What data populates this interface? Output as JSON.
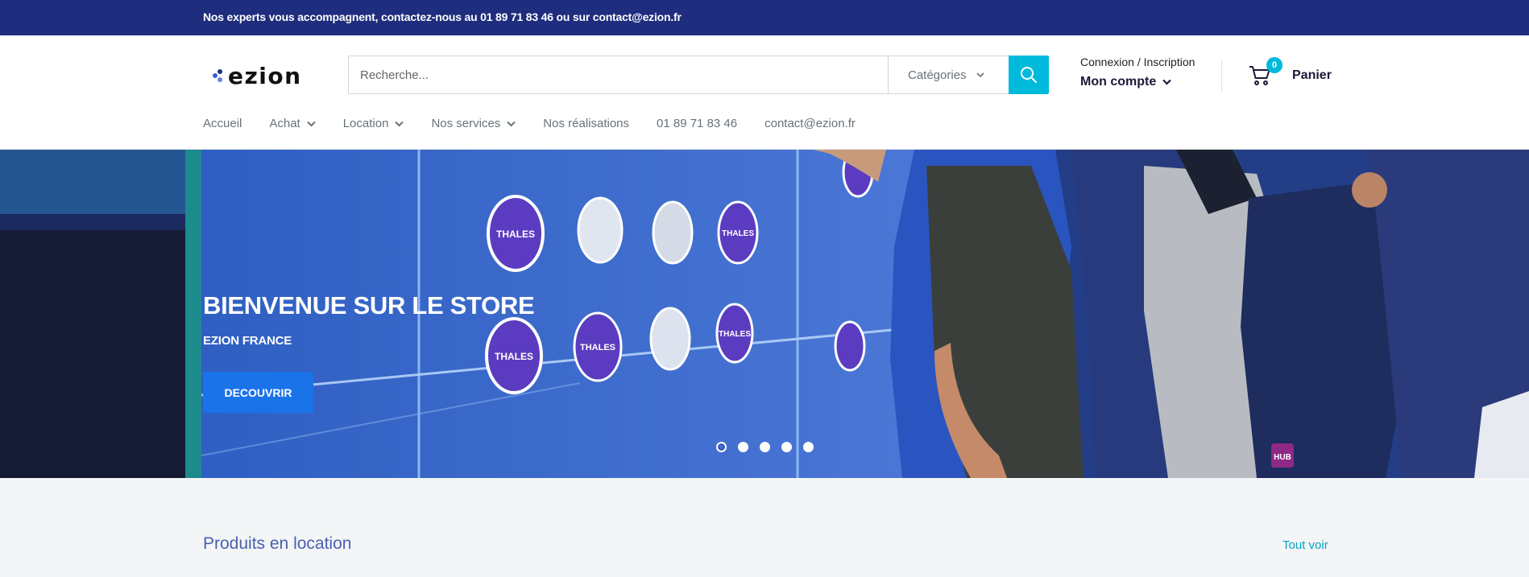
{
  "topbar": {
    "text": "Nos experts vous accompagnent, contactez-nous au 01 89 71 83 46 ou sur contact@ezion.fr"
  },
  "brand": {
    "logo_text": "ezion",
    "primary": "#1e2d7d",
    "accent": "#00badb",
    "cta": "#1a73e8"
  },
  "search": {
    "placeholder": "Recherche...",
    "category_label": "Catégories"
  },
  "account": {
    "login_label": "Connexion / Inscription",
    "account_label": "Mon compte"
  },
  "cart": {
    "count": "0",
    "label": "Panier"
  },
  "nav": {
    "items": [
      {
        "label": "Accueil",
        "has_dropdown": false
      },
      {
        "label": "Achat",
        "has_dropdown": true
      },
      {
        "label": "Location",
        "has_dropdown": true
      },
      {
        "label": "Nos services",
        "has_dropdown": true
      },
      {
        "label": "Nos réalisations",
        "has_dropdown": false
      },
      {
        "label": "01 89 71 83 46",
        "has_dropdown": false
      },
      {
        "label": "contact@ezion.fr",
        "has_dropdown": false
      }
    ]
  },
  "hero": {
    "title": "BIENVENUE SUR LE STORE",
    "subtitle": "EZION FRANCE",
    "cta_label": "DECOUVRIR",
    "slide_count": 5,
    "active_slide": 1,
    "wall_badge_text": "THALES",
    "backpack_patch_text": "HUB"
  },
  "section": {
    "title": "Produits en location",
    "view_all_label": "Tout voir"
  }
}
